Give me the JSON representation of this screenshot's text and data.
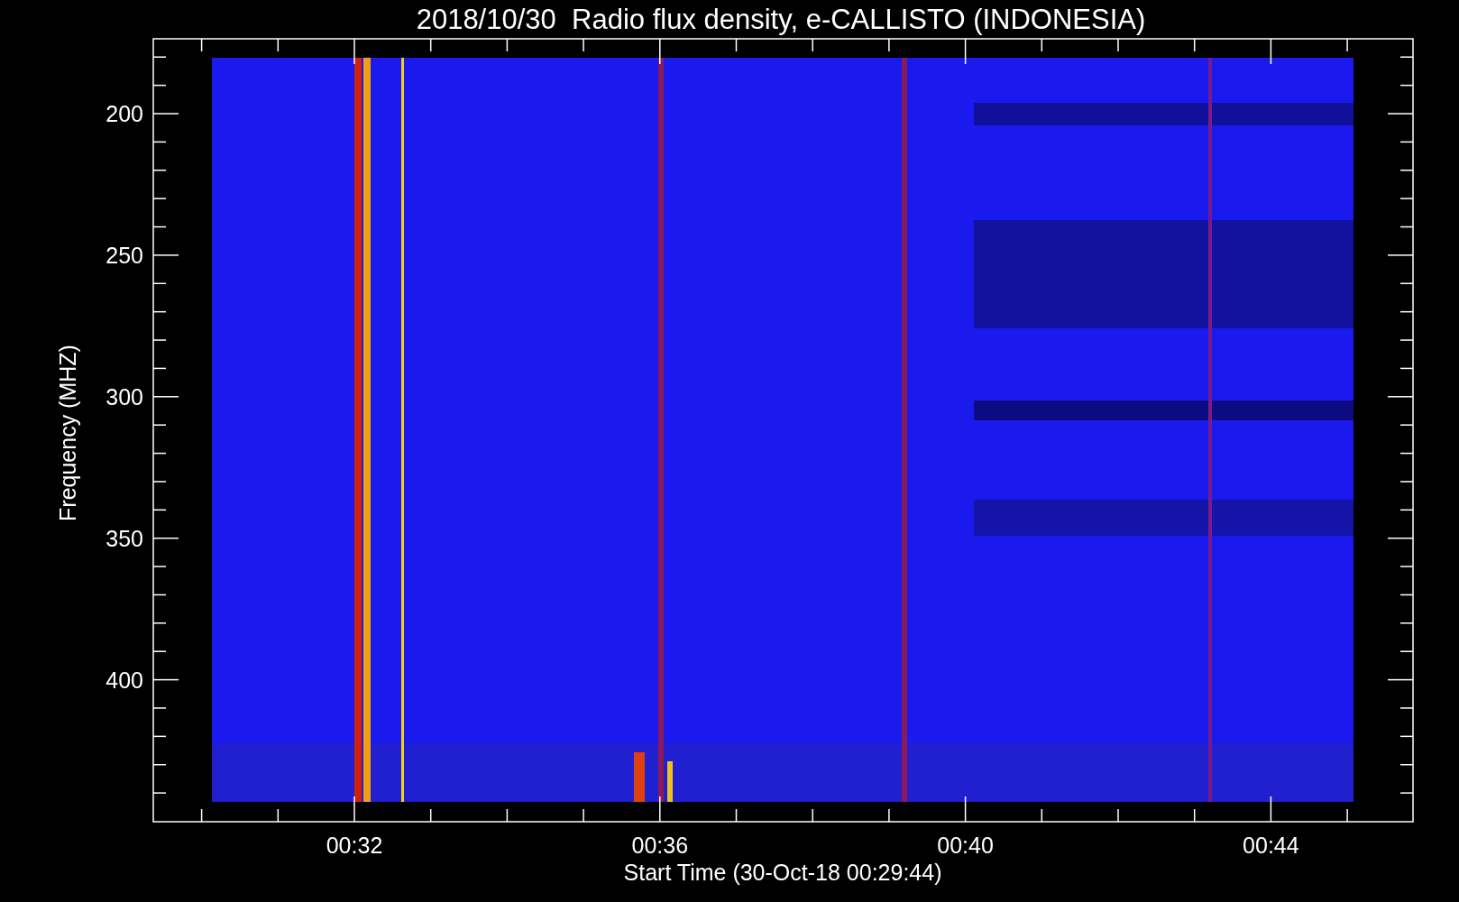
{
  "title": "2018/10/30  Radio flux density, e-CALLISTO (INDONESIA)",
  "y_axis": {
    "label": "Frequency (MHZ)",
    "ticks": [
      "200",
      "250",
      "300",
      "350",
      "400"
    ]
  },
  "x_axis": {
    "label": "Start Time (30-Oct-18 00:29:44)",
    "ticks": [
      "00:32",
      "00:36",
      "00:40",
      "00:44"
    ]
  }
}
